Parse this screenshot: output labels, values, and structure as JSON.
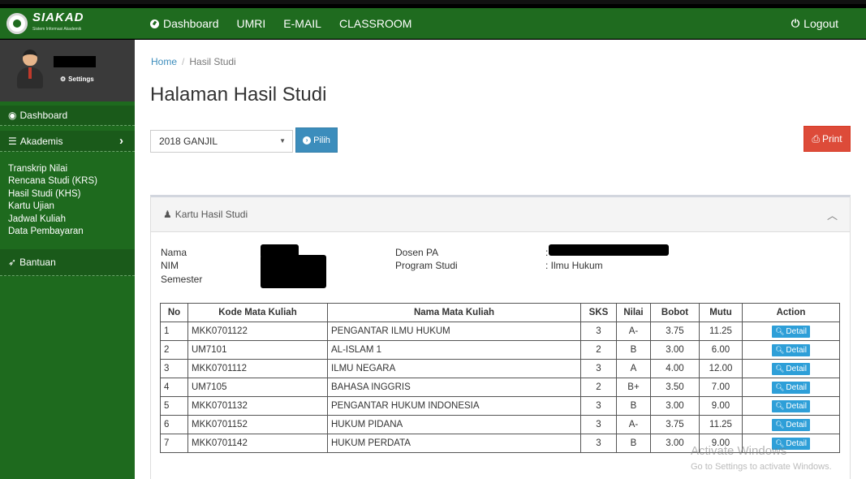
{
  "brand": {
    "name": "SIAKAD",
    "subtitle": "Sistem Informasi Akademik"
  },
  "topnav": {
    "dashboard": "Dashboard",
    "umri": "UMRI",
    "email": "E-MAIL",
    "classroom": "CLASSROOM",
    "logout": "Logout"
  },
  "user": {
    "settings": "Settings"
  },
  "sidebar": {
    "dashboard": "Dashboard",
    "akademis": "Akademis",
    "submenu": [
      "Transkrip Nilai",
      "Rencana Studi (KRS)",
      "Hasil Studi (KHS)",
      "Kartu Ujian",
      "Jadwal Kuliah",
      "Data Pembayaran"
    ],
    "bantuan": "Bantuan"
  },
  "breadcrumb": {
    "home": "Home",
    "current": "Hasil Studi"
  },
  "page": {
    "title": "Halaman Hasil Studi"
  },
  "filter": {
    "semester": "2018 GANJIL",
    "pilih": "Pilih",
    "print": "Print"
  },
  "card": {
    "title": "Kartu Hasil Studi"
  },
  "info": {
    "nama_label": "Nama",
    "nim_label": "NIM",
    "semester_label": "Semester",
    "dosen_label": "Dosen PA",
    "prodi_label": "Program Studi",
    "dosen_sep": ":",
    "prodi_value": ": Ilmu Hukum"
  },
  "table": {
    "headers": [
      "No",
      "Kode Mata Kuliah",
      "Nama Mata Kuliah",
      "SKS",
      "Nilai",
      "Bobot",
      "Mutu",
      "Action"
    ],
    "detail_label": "Detail",
    "rows": [
      {
        "no": "1",
        "kode": "MKK0701122",
        "nama": "PENGANTAR ILMU HUKUM",
        "sks": "3",
        "nilai": "A-",
        "bobot": "3.75",
        "mutu": "11.25"
      },
      {
        "no": "2",
        "kode": "UM7101",
        "nama": "AL-ISLAM 1",
        "sks": "2",
        "nilai": "B",
        "bobot": "3.00",
        "mutu": "6.00"
      },
      {
        "no": "3",
        "kode": "MKK0701112",
        "nama": "ILMU NEGARA",
        "sks": "3",
        "nilai": "A",
        "bobot": "4.00",
        "mutu": "12.00"
      },
      {
        "no": "4",
        "kode": "UM7105",
        "nama": "BAHASA INGGRIS",
        "sks": "2",
        "nilai": "B+",
        "bobot": "3.50",
        "mutu": "7.00"
      },
      {
        "no": "5",
        "kode": "MKK0701132",
        "nama": "PENGANTAR HUKUM INDONESIA",
        "sks": "3",
        "nilai": "B",
        "bobot": "3.00",
        "mutu": "9.00"
      },
      {
        "no": "6",
        "kode": "MKK0701152",
        "nama": "HUKUM PIDANA",
        "sks": "3",
        "nilai": "A-",
        "bobot": "3.75",
        "mutu": "11.25"
      },
      {
        "no": "7",
        "kode": "MKK0701142",
        "nama": "HUKUM PERDATA",
        "sks": "3",
        "nilai": "B",
        "bobot": "3.00",
        "mutu": "9.00"
      }
    ]
  },
  "watermark": {
    "line1": "Activate Windows",
    "line2": "Go to Settings to activate Windows."
  },
  "colors": {
    "topbar": "#1f6b1f",
    "sidebar": "#1e6a1e",
    "primary": "#3c8dbc",
    "danger": "#dd4b39",
    "detail": "#2e9fd8"
  }
}
